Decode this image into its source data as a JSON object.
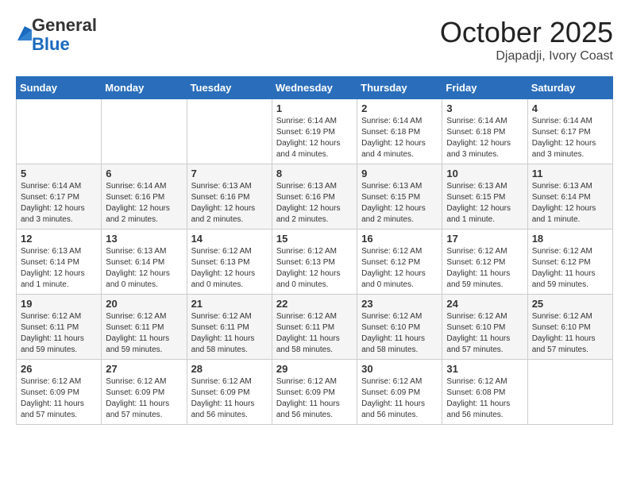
{
  "logo": {
    "general": "General",
    "blue": "Blue"
  },
  "header": {
    "month": "October 2025",
    "location": "Djapadji, Ivory Coast"
  },
  "weekdays": [
    "Sunday",
    "Monday",
    "Tuesday",
    "Wednesday",
    "Thursday",
    "Friday",
    "Saturday"
  ],
  "weeks": [
    [
      {
        "day": "",
        "sunrise": "",
        "sunset": "",
        "daylight": ""
      },
      {
        "day": "",
        "sunrise": "",
        "sunset": "",
        "daylight": ""
      },
      {
        "day": "",
        "sunrise": "",
        "sunset": "",
        "daylight": ""
      },
      {
        "day": "1",
        "sunrise": "Sunrise: 6:14 AM",
        "sunset": "Sunset: 6:19 PM",
        "daylight": "Daylight: 12 hours and 4 minutes."
      },
      {
        "day": "2",
        "sunrise": "Sunrise: 6:14 AM",
        "sunset": "Sunset: 6:18 PM",
        "daylight": "Daylight: 12 hours and 4 minutes."
      },
      {
        "day": "3",
        "sunrise": "Sunrise: 6:14 AM",
        "sunset": "Sunset: 6:18 PM",
        "daylight": "Daylight: 12 hours and 3 minutes."
      },
      {
        "day": "4",
        "sunrise": "Sunrise: 6:14 AM",
        "sunset": "Sunset: 6:17 PM",
        "daylight": "Daylight: 12 hours and 3 minutes."
      }
    ],
    [
      {
        "day": "5",
        "sunrise": "Sunrise: 6:14 AM",
        "sunset": "Sunset: 6:17 PM",
        "daylight": "Daylight: 12 hours and 3 minutes."
      },
      {
        "day": "6",
        "sunrise": "Sunrise: 6:14 AM",
        "sunset": "Sunset: 6:16 PM",
        "daylight": "Daylight: 12 hours and 2 minutes."
      },
      {
        "day": "7",
        "sunrise": "Sunrise: 6:13 AM",
        "sunset": "Sunset: 6:16 PM",
        "daylight": "Daylight: 12 hours and 2 minutes."
      },
      {
        "day": "8",
        "sunrise": "Sunrise: 6:13 AM",
        "sunset": "Sunset: 6:16 PM",
        "daylight": "Daylight: 12 hours and 2 minutes."
      },
      {
        "day": "9",
        "sunrise": "Sunrise: 6:13 AM",
        "sunset": "Sunset: 6:15 PM",
        "daylight": "Daylight: 12 hours and 2 minutes."
      },
      {
        "day": "10",
        "sunrise": "Sunrise: 6:13 AM",
        "sunset": "Sunset: 6:15 PM",
        "daylight": "Daylight: 12 hours and 1 minute."
      },
      {
        "day": "11",
        "sunrise": "Sunrise: 6:13 AM",
        "sunset": "Sunset: 6:14 PM",
        "daylight": "Daylight: 12 hours and 1 minute."
      }
    ],
    [
      {
        "day": "12",
        "sunrise": "Sunrise: 6:13 AM",
        "sunset": "Sunset: 6:14 PM",
        "daylight": "Daylight: 12 hours and 1 minute."
      },
      {
        "day": "13",
        "sunrise": "Sunrise: 6:13 AM",
        "sunset": "Sunset: 6:14 PM",
        "daylight": "Daylight: 12 hours and 0 minutes."
      },
      {
        "day": "14",
        "sunrise": "Sunrise: 6:12 AM",
        "sunset": "Sunset: 6:13 PM",
        "daylight": "Daylight: 12 hours and 0 minutes."
      },
      {
        "day": "15",
        "sunrise": "Sunrise: 6:12 AM",
        "sunset": "Sunset: 6:13 PM",
        "daylight": "Daylight: 12 hours and 0 minutes."
      },
      {
        "day": "16",
        "sunrise": "Sunrise: 6:12 AM",
        "sunset": "Sunset: 6:12 PM",
        "daylight": "Daylight: 12 hours and 0 minutes."
      },
      {
        "day": "17",
        "sunrise": "Sunrise: 6:12 AM",
        "sunset": "Sunset: 6:12 PM",
        "daylight": "Daylight: 11 hours and 59 minutes."
      },
      {
        "day": "18",
        "sunrise": "Sunrise: 6:12 AM",
        "sunset": "Sunset: 6:12 PM",
        "daylight": "Daylight: 11 hours and 59 minutes."
      }
    ],
    [
      {
        "day": "19",
        "sunrise": "Sunrise: 6:12 AM",
        "sunset": "Sunset: 6:11 PM",
        "daylight": "Daylight: 11 hours and 59 minutes."
      },
      {
        "day": "20",
        "sunrise": "Sunrise: 6:12 AM",
        "sunset": "Sunset: 6:11 PM",
        "daylight": "Daylight: 11 hours and 59 minutes."
      },
      {
        "day": "21",
        "sunrise": "Sunrise: 6:12 AM",
        "sunset": "Sunset: 6:11 PM",
        "daylight": "Daylight: 11 hours and 58 minutes."
      },
      {
        "day": "22",
        "sunrise": "Sunrise: 6:12 AM",
        "sunset": "Sunset: 6:11 PM",
        "daylight": "Daylight: 11 hours and 58 minutes."
      },
      {
        "day": "23",
        "sunrise": "Sunrise: 6:12 AM",
        "sunset": "Sunset: 6:10 PM",
        "daylight": "Daylight: 11 hours and 58 minutes."
      },
      {
        "day": "24",
        "sunrise": "Sunrise: 6:12 AM",
        "sunset": "Sunset: 6:10 PM",
        "daylight": "Daylight: 11 hours and 57 minutes."
      },
      {
        "day": "25",
        "sunrise": "Sunrise: 6:12 AM",
        "sunset": "Sunset: 6:10 PM",
        "daylight": "Daylight: 11 hours and 57 minutes."
      }
    ],
    [
      {
        "day": "26",
        "sunrise": "Sunrise: 6:12 AM",
        "sunset": "Sunset: 6:09 PM",
        "daylight": "Daylight: 11 hours and 57 minutes."
      },
      {
        "day": "27",
        "sunrise": "Sunrise: 6:12 AM",
        "sunset": "Sunset: 6:09 PM",
        "daylight": "Daylight: 11 hours and 57 minutes."
      },
      {
        "day": "28",
        "sunrise": "Sunrise: 6:12 AM",
        "sunset": "Sunset: 6:09 PM",
        "daylight": "Daylight: 11 hours and 56 minutes."
      },
      {
        "day": "29",
        "sunrise": "Sunrise: 6:12 AM",
        "sunset": "Sunset: 6:09 PM",
        "daylight": "Daylight: 11 hours and 56 minutes."
      },
      {
        "day": "30",
        "sunrise": "Sunrise: 6:12 AM",
        "sunset": "Sunset: 6:09 PM",
        "daylight": "Daylight: 11 hours and 56 minutes."
      },
      {
        "day": "31",
        "sunrise": "Sunrise: 6:12 AM",
        "sunset": "Sunset: 6:08 PM",
        "daylight": "Daylight: 11 hours and 56 minutes."
      },
      {
        "day": "",
        "sunrise": "",
        "sunset": "",
        "daylight": ""
      }
    ]
  ]
}
